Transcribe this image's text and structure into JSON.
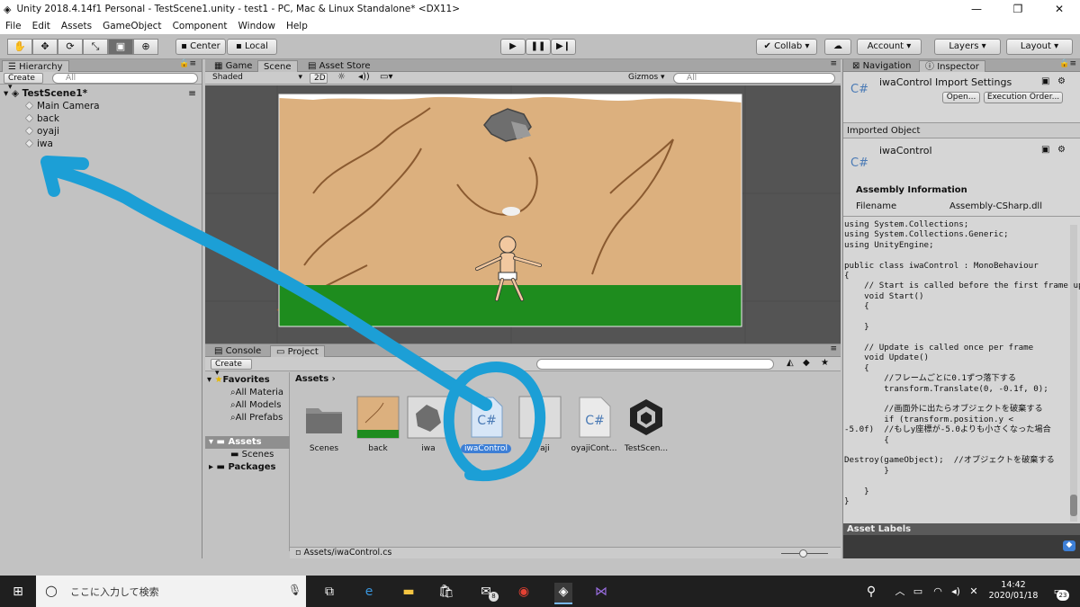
{
  "window": {
    "title": "Unity 2018.4.14f1 Personal - TestScene1.unity - test1 - PC, Mac & Linux Standalone* <DX11>"
  },
  "menu": [
    "File",
    "Edit",
    "Assets",
    "GameObject",
    "Component",
    "Window",
    "Help"
  ],
  "toolbar": {
    "center": "Center",
    "local": "Local",
    "collab": "Collab",
    "account": "Account",
    "layers": "Layers",
    "layout": "Layout"
  },
  "hierarchy": {
    "tab": "Hierarchy",
    "create": "Create",
    "search_placeholder": "All",
    "scene": "TestScene1*",
    "items": [
      "Main Camera",
      "back",
      "oyaji",
      "iwa"
    ]
  },
  "scene_tabs": {
    "game": "Game",
    "scene": "Scene",
    "store": "Asset Store",
    "shading": "Shaded",
    "mode2d": "2D",
    "gizmos": "Gizmos",
    "search_placeholder": "All"
  },
  "bottom_tabs": {
    "console": "Console",
    "project": "Project",
    "create": "Create"
  },
  "project": {
    "favorites": "Favorites",
    "fav_items": [
      "All Materia",
      "All Models",
      "All Prefabs"
    ],
    "assets_root": "Assets",
    "scenes": "Scenes",
    "packages": "Packages",
    "breadcrumb": "Assets",
    "asset_items": [
      "Scenes",
      "back",
      "iwa",
      "iwaControl",
      "oyaji",
      "oyajiCont...",
      "TestScen..."
    ],
    "status_path": "Assets/iwaControl.cs"
  },
  "inspector": {
    "tab_nav": "Navigation",
    "tab_insp": "Inspector",
    "import_title": "iwaControl Import Settings",
    "open": "Open...",
    "exec": "Execution Order...",
    "imported_object": "Imported Object",
    "obj_name": "iwaControl",
    "assembly_info": "Assembly Information",
    "filename_label": "Filename",
    "filename_value": "Assembly-CSharp.dll",
    "code": "using System.Collections;\nusing System.Collections.Generic;\nusing UnityEngine;\n\npublic class iwaControl : MonoBehaviour\n{\n    // Start is called before the first frame update\n    void Start()\n    {\n\n    }\n\n    // Update is called once per frame\n    void Update()\n    {\n        //フレームごとに0.1ずつ落下する\n        transform.Translate(0, -0.1f, 0);\n\n        //画面外に出たらオブジェクトを破棄する\n        if (transform.position.y <\n-5.0f)  //もしy座標が-5.0よりも小さくなった場合\n        {\n\nDestroy(gameObject);  //オブジェクトを破棄する\n        }\n\n    }\n}",
    "asset_labels": "Asset Labels"
  },
  "taskbar": {
    "search_placeholder": "ここに入力して検索",
    "time": "14:42",
    "date": "2020/01/18",
    "notif_count": "23",
    "mail_badge": "8"
  }
}
